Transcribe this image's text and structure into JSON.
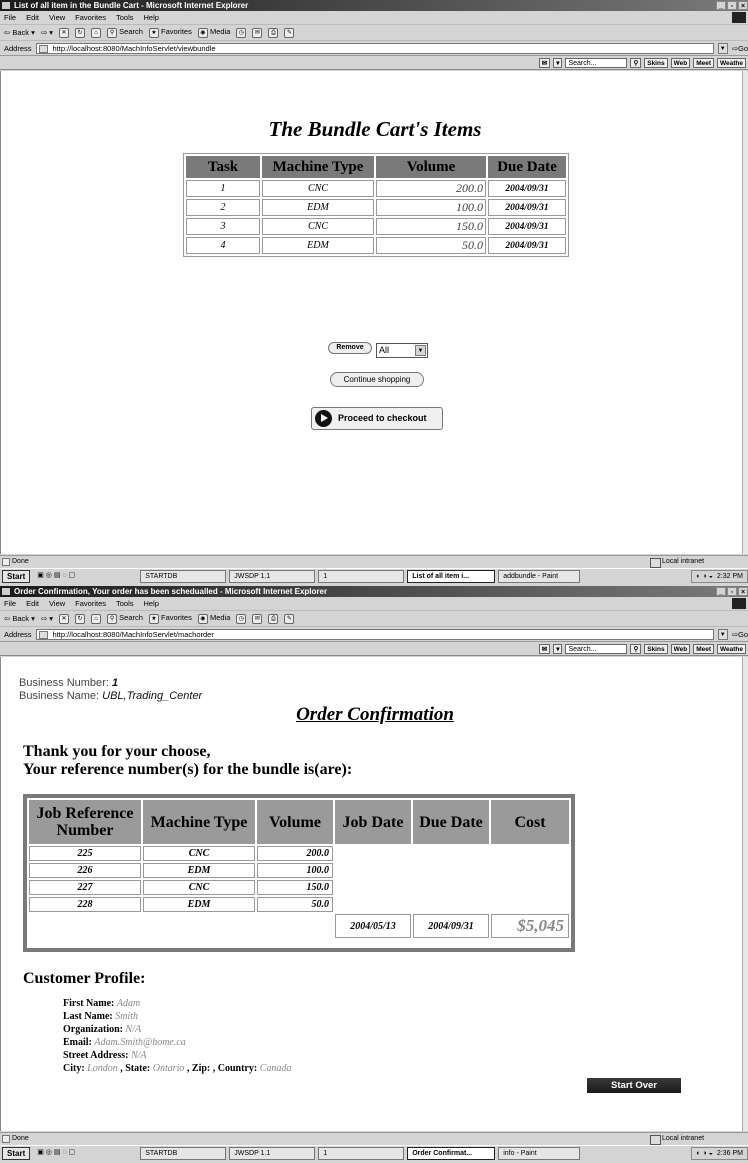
{
  "window1": {
    "title": "List of all item in the Bundle Cart - Microsoft Internet Explorer",
    "menu": [
      "File",
      "Edit",
      "View",
      "Favorites",
      "Tools",
      "Help"
    ],
    "toolbar": {
      "back": "Back",
      "search": "Search",
      "favorites": "Favorites",
      "media": "Media"
    },
    "address_label": "Address",
    "url": "http://localhost:8080/MachInfoServlet/viewbundle",
    "go": "Go",
    "linkbar": {
      "search_placeholder": "Search...",
      "skins": "Skins",
      "web": "Web",
      "meet": "Meet",
      "weather": "Weathe"
    },
    "page": {
      "title": "The Bundle Cart's Items",
      "headers": [
        "Task",
        "Machine Type",
        "Volume",
        "Due Date"
      ],
      "rows": [
        {
          "task": "1",
          "type": "CNC",
          "volume": "200.0",
          "due": "2004/09/31"
        },
        {
          "task": "2",
          "type": "EDM",
          "volume": "100.0",
          "due": "2004/09/31"
        },
        {
          "task": "3",
          "type": "CNC",
          "volume": "150.0",
          "due": "2004/09/31"
        },
        {
          "task": "4",
          "type": "EDM",
          "volume": "50.0",
          "due": "2004/09/31"
        }
      ],
      "remove_label": "Remove",
      "remove_select": "All",
      "continue_label": "Continue shopping",
      "checkout_label": "Proceed to checkout"
    },
    "status": "Done",
    "zone": "Local intranet",
    "taskbar": {
      "start": "Start",
      "items": [
        "STARTDB",
        "JWSDP 1.1",
        "1",
        "List of all item i...",
        "addbundle - Paint"
      ],
      "clock": "2:32 PM"
    }
  },
  "window2": {
    "title": "Order Confirmation, Your order has been schedualled - Microsoft Internet Explorer",
    "menu": [
      "File",
      "Edit",
      "View",
      "Favorites",
      "Tools",
      "Help"
    ],
    "toolbar": {
      "back": "Back",
      "search": "Search",
      "favorites": "Favorites",
      "media": "Media"
    },
    "address_label": "Address",
    "url": "http://localhost:8080/MachInfoServlet/machorder",
    "go": "Go",
    "linkbar": {
      "search_placeholder": "Search...",
      "skins": "Skins",
      "web": "Web",
      "meet": "Meet",
      "weather": "Weathe"
    },
    "page": {
      "business_number_label": "Business Number:",
      "business_number": "1",
      "business_name_label": "Business Name:",
      "business_name": "UBL,Trading_Center",
      "title": "Order Confirmation",
      "thanks_line1": "Thank you for your choose,",
      "thanks_line2": "Your reference number(s) for the bundle is(are):",
      "headers": [
        "Job Reference Number",
        "Machine Type",
        "Volume",
        "Job Date",
        "Due Date",
        "Cost"
      ],
      "rows": [
        {
          "ref": "225",
          "type": "CNC",
          "volume": "200.0"
        },
        {
          "ref": "226",
          "type": "EDM",
          "volume": "100.0"
        },
        {
          "ref": "227",
          "type": "CNC",
          "volume": "150.0"
        },
        {
          "ref": "228",
          "type": "EDM",
          "volume": "50.0"
        }
      ],
      "job_date": "2004/05/13",
      "due_date": "2004/09/31",
      "cost": "$5,045",
      "profile_title": "Customer Profile:",
      "profile": {
        "first_name_label": "First Name:",
        "first_name": "Adam",
        "last_name_label": "Last Name:",
        "last_name": "Smith",
        "org_label": "Organization:",
        "org": "N/A",
        "email_label": "Email:",
        "email": "Adam.Smith@home.ca",
        "street_label": "Street Address:",
        "street": "N/A",
        "city_label": "City:",
        "city": "London",
        "state_label": "State:",
        "state": "Ontario",
        "zip_label": "Zip:",
        "zip": "",
        "country_label": "Country:",
        "country": "Canada"
      },
      "start_over": "Start Over"
    },
    "status": "Done",
    "zone": "Local intranet",
    "taskbar": {
      "start": "Start",
      "items": [
        "STARTDB",
        "JWSDP 1.1",
        "1",
        "Order Confirmat...",
        "info - Paint"
      ],
      "clock": "2:36 PM"
    }
  }
}
